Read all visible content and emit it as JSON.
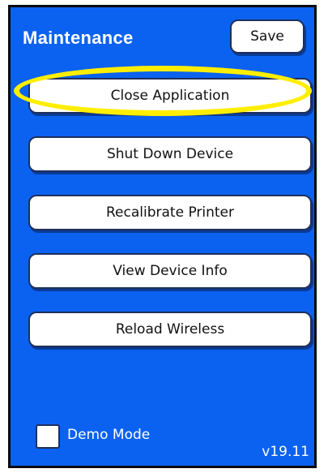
{
  "header": {
    "title": "Maintenance",
    "save_label": "Save"
  },
  "menu": {
    "items": [
      {
        "label": "Close Application",
        "highlighted": true
      },
      {
        "label": "Shut Down Device",
        "highlighted": false
      },
      {
        "label": "Recalibrate Printer",
        "highlighted": false
      },
      {
        "label": "View Device Info",
        "highlighted": false
      },
      {
        "label": "Reload Wireless",
        "highlighted": false
      }
    ]
  },
  "footer": {
    "demo_mode_label": "Demo Mode",
    "demo_mode_checked": false,
    "version": "v19.11"
  },
  "colors": {
    "background": "#0b62f0",
    "button": "#ffffff",
    "highlight": "#ffee00",
    "text_light": "#ffffff"
  }
}
